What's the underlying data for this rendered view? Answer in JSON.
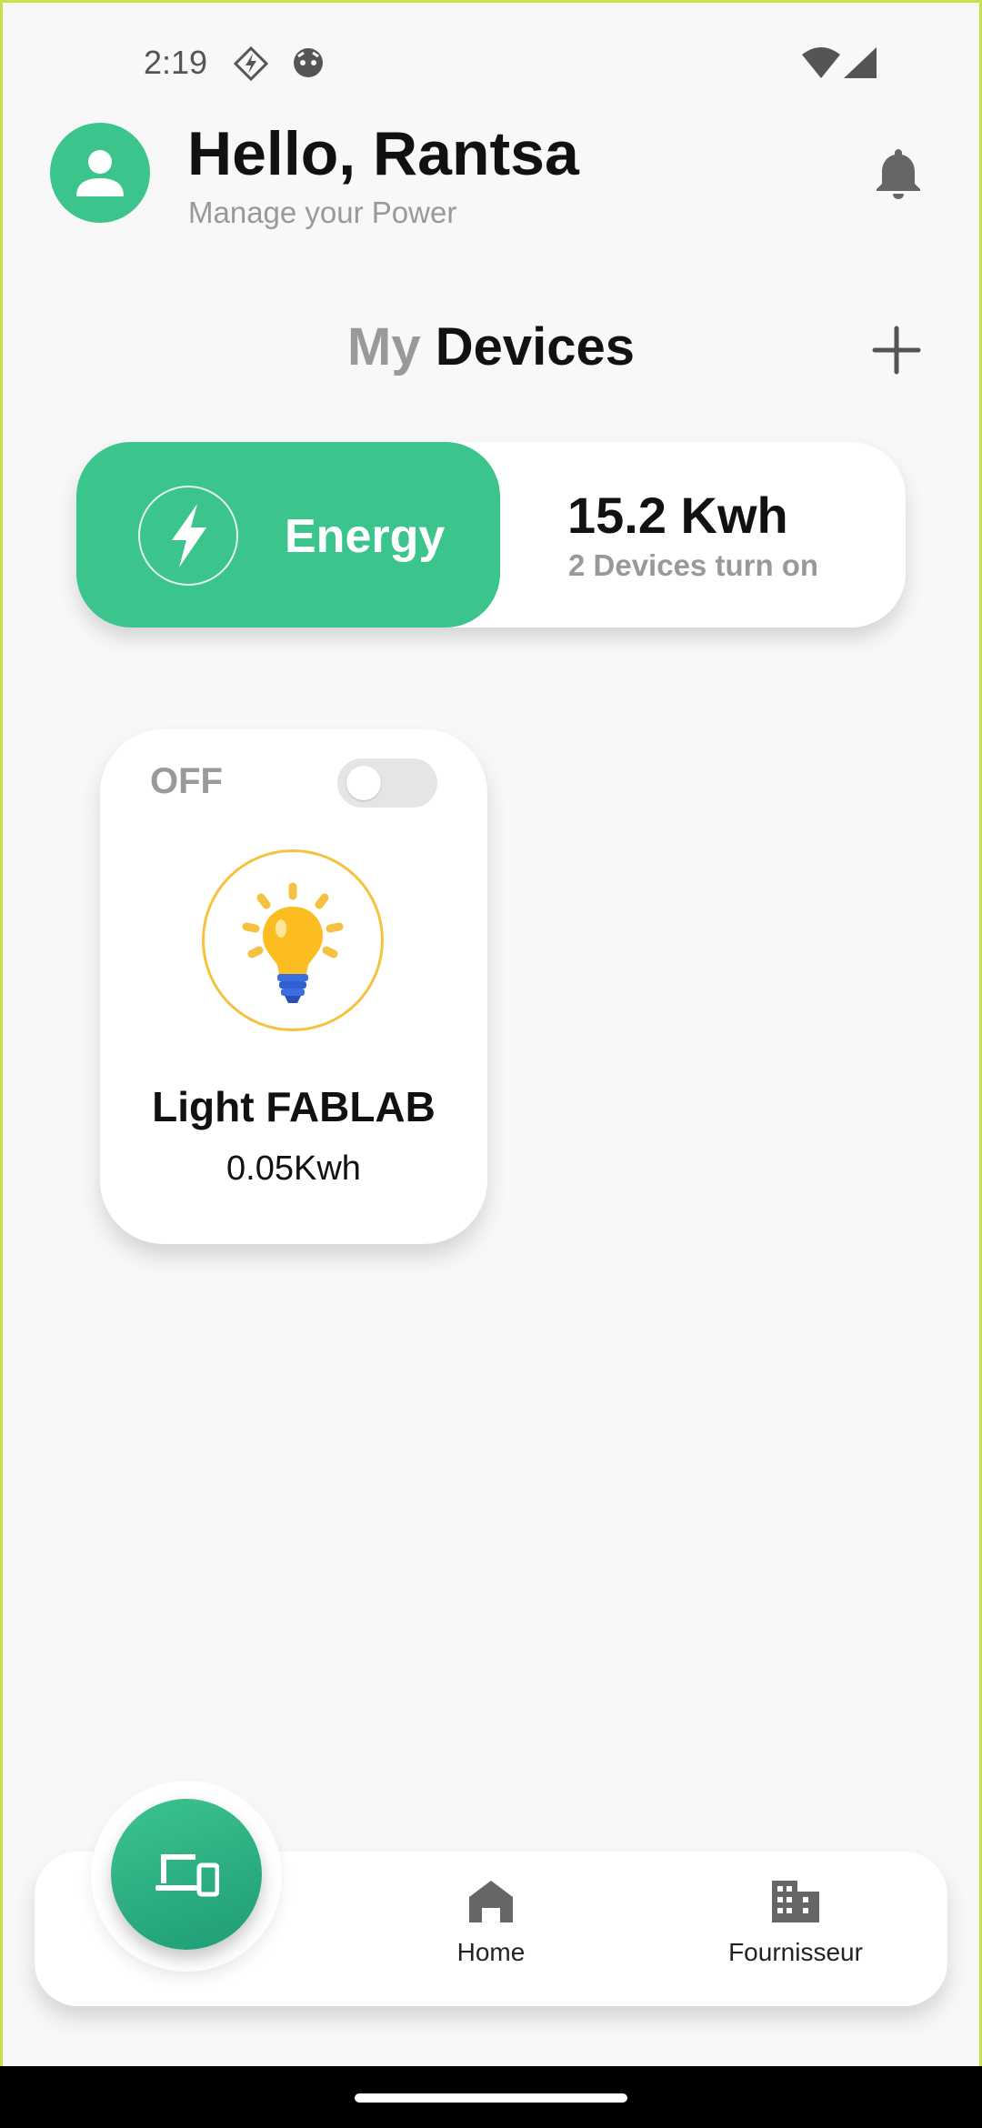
{
  "status_bar": {
    "time": "2:19"
  },
  "header": {
    "greeting": "Hello, Rantsa",
    "subtitle": "Manage your Power"
  },
  "section": {
    "title_prefix": "My",
    "title_main": "Devices"
  },
  "energy": {
    "label": "Energy",
    "value": "15.2 Kwh",
    "sub": "2 Devices turn on"
  },
  "device": {
    "status": "OFF",
    "name": "Light FABLAB",
    "usage": "0.05Kwh",
    "on": false
  },
  "nav": {
    "home_label": "Home",
    "supplier_label": "Fournisseur"
  },
  "colors": {
    "accent": "#3cc48d",
    "bulb_ring": "#f5c23f"
  },
  "icons": [
    "person-icon",
    "bell-icon",
    "plus-icon",
    "bolt-icon",
    "lightbulb-icon",
    "devices-icon",
    "home-icon",
    "building-icon",
    "wifi-icon",
    "signal-icon"
  ]
}
